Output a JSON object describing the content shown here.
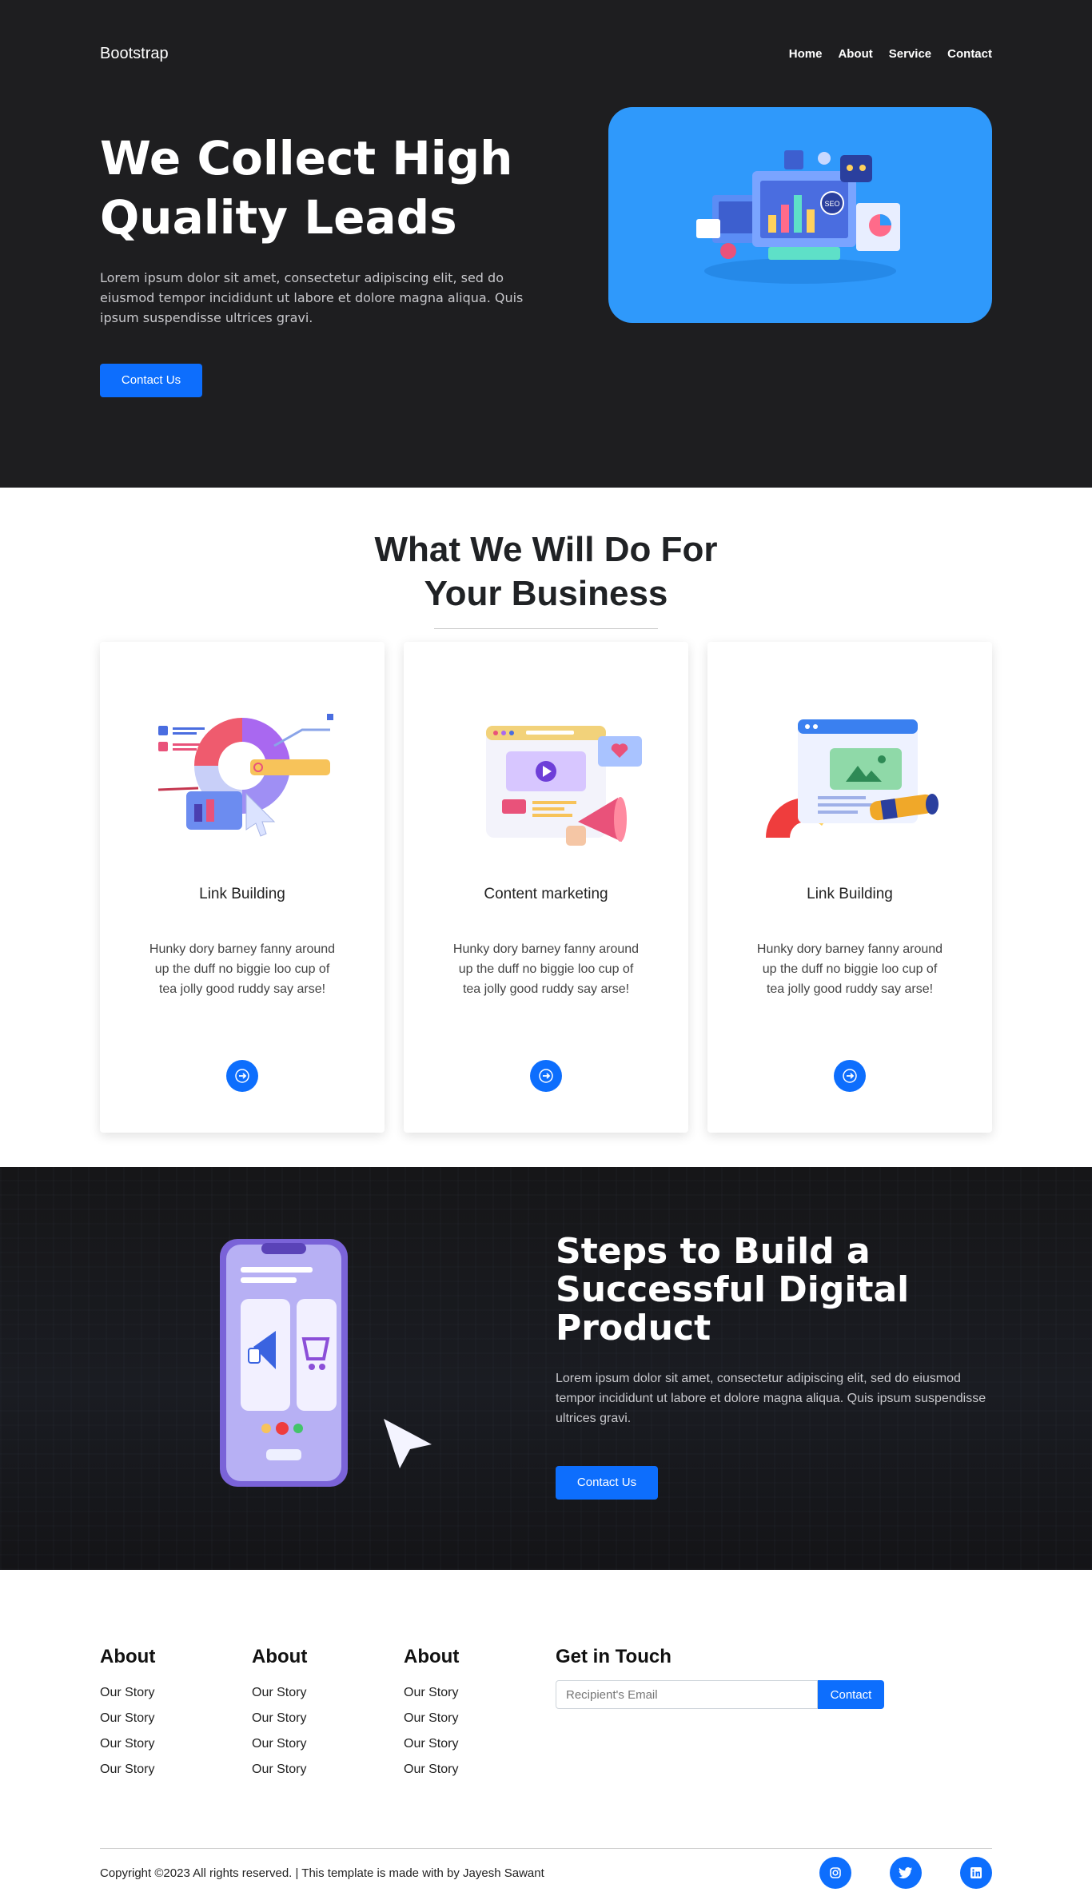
{
  "header": {
    "brand": "Bootstrap",
    "nav": [
      "Home",
      "About",
      "Service",
      "Contact"
    ]
  },
  "hero": {
    "title": "We Collect High Quality Leads",
    "text": "Lorem ipsum dolor sit amet, consectetur adipiscing elit, sed do eiusmod tempor incididunt ut labore et dolore magna aliqua. Quis ipsum suspendisse ultrices gravi.",
    "button": "Contact Us",
    "art_label": "SEO"
  },
  "services": {
    "title": "What We Will Do For Your Business",
    "cards": [
      {
        "title": "Link Building",
        "text": "Hunky dory barney fanny around up the duff no biggie loo cup of tea jolly good ruddy say arse!"
      },
      {
        "title": "Content marketing",
        "text": "Hunky dory barney fanny around up the duff no biggie loo cup of tea jolly good ruddy say arse!"
      },
      {
        "title": "Link Building",
        "text": "Hunky dory barney fanny around up the duff no biggie loo cup of tea jolly good ruddy say arse!"
      }
    ]
  },
  "steps": {
    "title": "Steps to Build a Successful Digital Product",
    "text": "Lorem ipsum dolor sit amet, consectetur adipiscing elit, sed do eiusmod tempor incididunt ut labore et dolore magna aliqua. Quis ipsum suspendisse ultrices gravi.",
    "button": "Contact Us"
  },
  "footer": {
    "columns": [
      {
        "heading": "About",
        "links": [
          "Our Story",
          "Our Story",
          "Our Story",
          "Our Story"
        ]
      },
      {
        "heading": "About",
        "links": [
          "Our Story",
          "Our Story",
          "Our Story",
          "Our Story"
        ]
      },
      {
        "heading": "About",
        "links": [
          "Our Story",
          "Our Story",
          "Our Story",
          "Our Story"
        ]
      }
    ],
    "touch": {
      "heading": "Get in Touch",
      "placeholder": "Recipient's Email",
      "button": "Contact"
    },
    "copyright": "Copyright ©2023 All rights reserved. | This template is made with by Jayesh Sawant",
    "social": [
      "instagram-icon",
      "twitter-icon",
      "linkedin-icon"
    ]
  },
  "colors": {
    "primary": "#0d6efd",
    "dark_bg": "#1e1e20",
    "hero_art_bg": "#2f99fb"
  }
}
